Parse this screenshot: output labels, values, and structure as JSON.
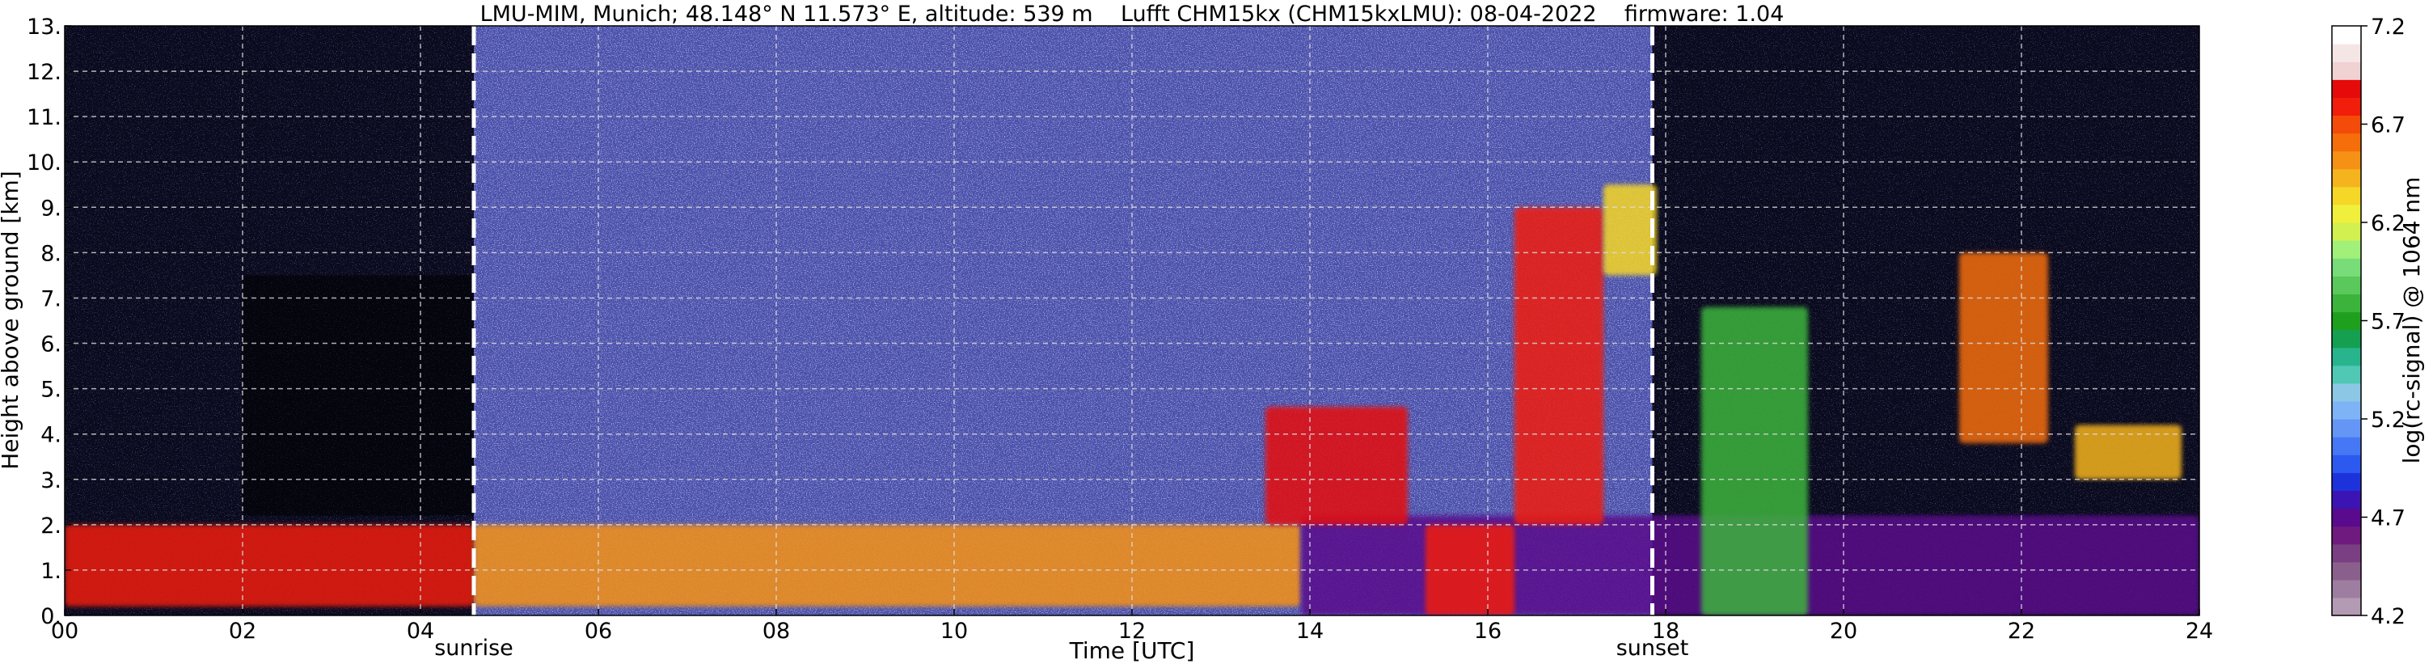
{
  "chart_data": {
    "type": "heatmap",
    "title": "LMU-MIM, Munich; 48.148° N 11.573° E, altitude: 539 m    Lufft CHM15kx (CHM15kxLMU): 08-04-2022    firmware: 1.04",
    "xlabel": "Time [UTC]",
    "ylabel": "Height above ground [km]",
    "xlim": [
      0,
      24
    ],
    "ylim": [
      0,
      13
    ],
    "x_ticks": [
      0,
      2,
      4,
      6,
      8,
      10,
      12,
      14,
      16,
      18,
      20,
      22,
      24
    ],
    "x_tick_labels": [
      "00",
      "02",
      "04",
      "06",
      "08",
      "10",
      "12",
      "14",
      "16",
      "18",
      "20",
      "22",
      "24"
    ],
    "y_ticks": [
      0,
      1,
      2,
      3,
      4,
      5,
      6,
      7,
      8,
      9,
      10,
      11,
      12,
      13
    ],
    "y_tick_labels": [
      "0.",
      "1.",
      "2.",
      "3.",
      "4.",
      "5.",
      "6.",
      "7.",
      "8.",
      "9.",
      "10.",
      "11.",
      "12.",
      "13."
    ],
    "grid": true,
    "markers": [
      {
        "label": "sunrise",
        "x": 4.6
      },
      {
        "label": "sunset",
        "x": 17.85
      }
    ],
    "colorbar": {
      "label": "log(rc-signal) @ 1064 nm",
      "min": 4.2,
      "max": 7.2,
      "ticks": [
        4.2,
        4.7,
        5.2,
        5.7,
        6.2,
        6.7,
        7.2
      ],
      "tick_labels": [
        "4.2",
        "4.7",
        "5.2",
        "5.7",
        "6.2",
        "6.7",
        "7.2"
      ],
      "colors": [
        "#b49bb4",
        "#9e7ea0",
        "#8a5f8c",
        "#7a3f82",
        "#6e1a7e",
        "#5a0a8c",
        "#3c14b4",
        "#1e32dc",
        "#2c5af0",
        "#4678f5",
        "#6496f5",
        "#7eb4f5",
        "#8cc8e6",
        "#50c8b4",
        "#28b48c",
        "#14a050",
        "#1ea01e",
        "#3cb43c",
        "#5ac85a",
        "#78dc78",
        "#a0f07a",
        "#d2f050",
        "#f0f03c",
        "#f5d728",
        "#f5b41e",
        "#f59114",
        "#f56e0a",
        "#f54b0a",
        "#f01e0a",
        "#e60a0a",
        "#f0d2d2",
        "#f5e6e6",
        "#ffffff"
      ]
    },
    "background_regions": [
      {
        "x": [
          0,
          4.6
        ],
        "y": [
          0,
          13
        ],
        "description": "night, dark background"
      },
      {
        "x": [
          4.6,
          17.85
        ],
        "y": [
          0,
          13
        ],
        "description": "day, blue noise background"
      },
      {
        "x": [
          17.85,
          24
        ],
        "y": [
          0,
          13
        ],
        "description": "night, dark background"
      }
    ],
    "layers": [
      {
        "x": [
          0.0,
          4.6
        ],
        "y": [
          0.2,
          2.0
        ],
        "value": 6.8
      },
      {
        "x": [
          4.6,
          13.9
        ],
        "y": [
          0.2,
          2.0
        ],
        "value": 6.5
      },
      {
        "x": [
          13.9,
          24
        ],
        "y": [
          0.0,
          2.2
        ],
        "value": 4.7
      },
      {
        "x": [
          13.5,
          15.1
        ],
        "y": [
          2.0,
          4.6
        ],
        "value": 6.9
      },
      {
        "x": [
          15.3,
          16.3
        ],
        "y": [
          0.0,
          2.0
        ],
        "value": 6.8
      },
      {
        "x": [
          16.3,
          17.3
        ],
        "y": [
          2.0,
          9.0
        ],
        "value": 6.8
      },
      {
        "x": [
          17.3,
          17.9
        ],
        "y": [
          7.5,
          9.5
        ],
        "value": 6.3
      },
      {
        "x": [
          18.4,
          19.6
        ],
        "y": [
          0.0,
          6.8
        ],
        "value": 5.8
      },
      {
        "x": [
          21.3,
          22.3
        ],
        "y": [
          3.8,
          8.0
        ],
        "value": 6.6
      },
      {
        "x": [
          22.6,
          23.8
        ],
        "y": [
          3.0,
          4.2
        ],
        "value": 6.4
      }
    ]
  }
}
